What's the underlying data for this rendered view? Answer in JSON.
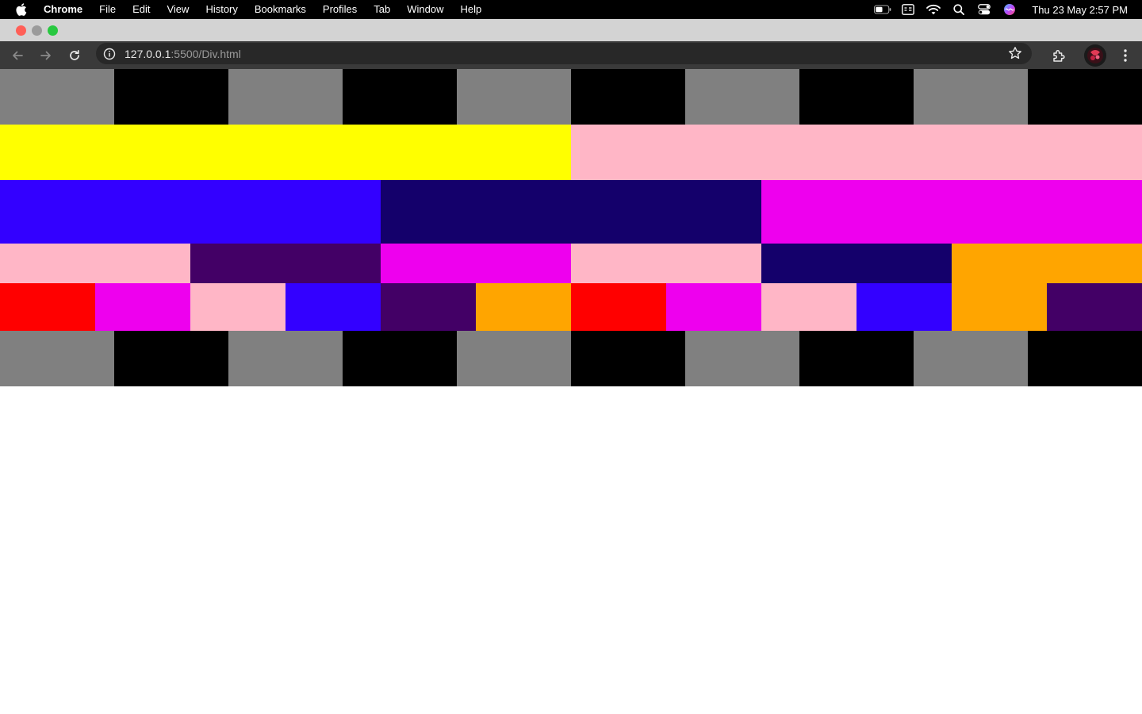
{
  "menubar": {
    "app_name": "Chrome",
    "items": [
      "File",
      "Edit",
      "View",
      "History",
      "Bookmarks",
      "Profiles",
      "Tab",
      "Window",
      "Help"
    ],
    "status_icons": [
      "battery-icon",
      "keyboard-input-icon",
      "wifi-icon",
      "spotlight-search-icon",
      "control-center-icon",
      "siri-icon"
    ],
    "clock": "Thu 23 May  2:57 PM"
  },
  "titlebar": {
    "lights": [
      "#ff5f57",
      "#9b9b9b",
      "#28c840"
    ]
  },
  "toolbar": {
    "url_host": "127.0.0.1",
    "url_path": ":5500/Div.html"
  },
  "page": {
    "rows": [
      {
        "height": 70,
        "cells": [
          "#808080",
          "#000000",
          "#808080",
          "#000000",
          "#808080",
          "#000000",
          "#808080",
          "#000000",
          "#808080",
          "#000000"
        ]
      },
      {
        "height": 70,
        "cells": [
          "#ffff00",
          "#ffb6c6"
        ]
      },
      {
        "height": 80,
        "cells": [
          "#3300ff",
          "#14006b",
          "#ee00ee"
        ]
      },
      {
        "height": 50,
        "cells": [
          "#ffb6c6",
          "#430066",
          "#ee00ee",
          "#ffb6c6",
          "#14006b",
          "#ffa500"
        ]
      },
      {
        "height": 60,
        "cells": [
          "#ff0000",
          "#ee00ee",
          "#ffb6c6",
          "#3300ff",
          "#430066",
          "#ffa500",
          "#ff0000",
          "#ee00ee",
          "#ffb6c6",
          "#3300ff",
          "#ffa500",
          "#430066"
        ]
      },
      {
        "height": 70,
        "cells": [
          "#808080",
          "#000000",
          "#808080",
          "#000000",
          "#808080",
          "#000000",
          "#808080",
          "#000000",
          "#808080",
          "#000000"
        ]
      }
    ]
  }
}
